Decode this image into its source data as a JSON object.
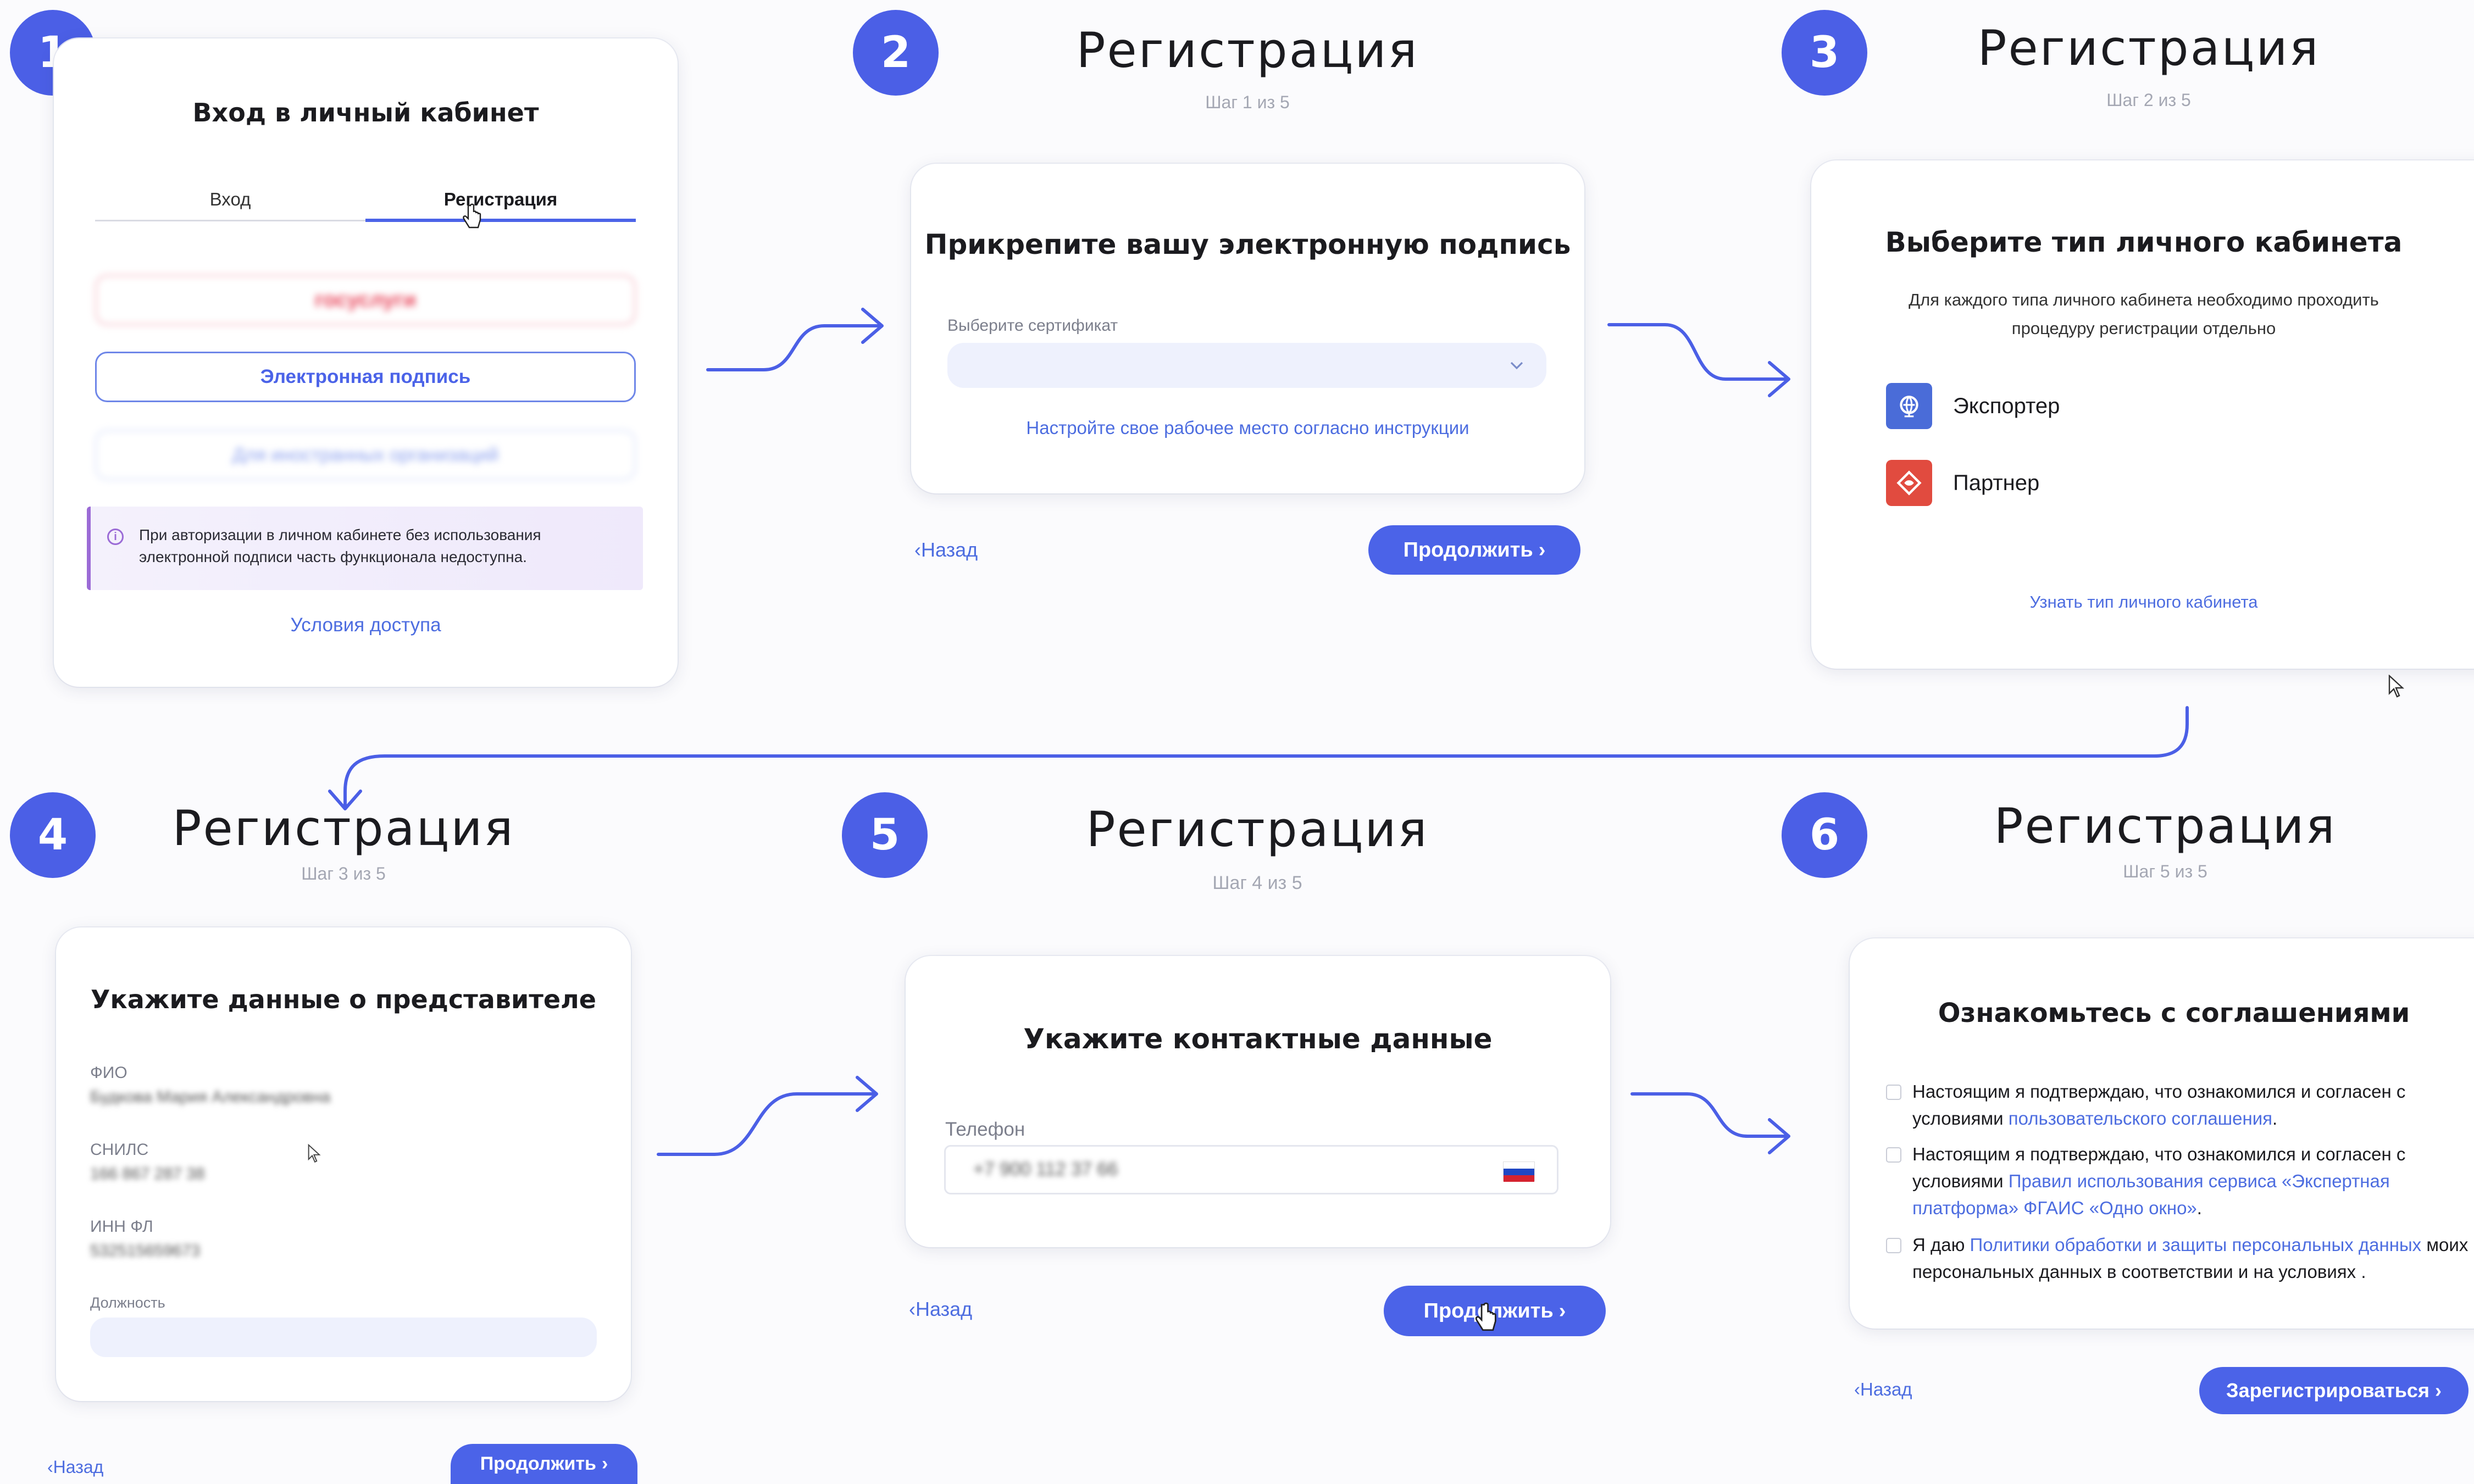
{
  "badges": [
    "1",
    "2",
    "3",
    "4",
    "5",
    "6"
  ],
  "reg_title": "Регистрация",
  "panel1": {
    "title": "Вход в личный кабинет",
    "tab_login": "Вход",
    "tab_register": "Регистрация",
    "gosuslugi_label": "госуслуги",
    "esign_button": "Электронная подпись",
    "org_button": "Для иностранных организаций",
    "info_text": "При авторизации в личном кабинете без использования электронной подписи часть функционала недоступна.",
    "access_link": "Условия доступа"
  },
  "panel2": {
    "step": "Шаг 1 из 5",
    "card_title": "Прикрепите вашу электронную подпись",
    "cert_label": "Выберите сертификат",
    "instruction_link": "Настройте свое рабочее место согласно инструкции",
    "back": "Назад",
    "continue": "Продолжить"
  },
  "panel3": {
    "step": "Шаг 2 из 5",
    "card_title": "Выберите тип личного кабинета",
    "description": "Для каждого типа личного кабинета необходимо проходить процедуру регистрации отдельно",
    "option_exporter": "Экспортер",
    "option_partner": "Партнер",
    "learn_link": "Узнать тип личного кабинета"
  },
  "panel4": {
    "step": "Шаг 3 из 5",
    "card_title": "Укажите данные о представителе",
    "fio_label": "ФИО",
    "fio_value": "Будкова Мария Александровна",
    "snils_label": "СНИЛС",
    "snils_value": "166 867 287 38",
    "inn_label": "ИНН ФЛ",
    "inn_value": "532515659673",
    "position_label": "Должность",
    "back": "Назад",
    "continue": "Продолжить"
  },
  "panel5": {
    "step": "Шаг 4 из 5",
    "card_title": "Укажите контактные данные",
    "phone_label": "Телефон",
    "phone_value": "+7 900 112 37 66",
    "back": "Назад",
    "continue": "Продолжить"
  },
  "panel6": {
    "step": "Шаг 5 из 5",
    "card_title": "Ознакомьтесь с соглашениями",
    "agree1_text": "Настоящим я подтверждаю, что ознакомился и согласен с условиями",
    "agree1_link": "пользовательского соглашения",
    "agree2_text": "Настоящим я подтверждаю, что ознакомился и согласен с условиями",
    "agree2_link": "Правил использования сервиса «Экспертная платформа» ФГАИС «Одно окно»",
    "agree3_prefix": "Я даю",
    "agree3_link": "Политики обработки и защиты персональных данных",
    "agree3_suffix": "моих персональных данных в соответствии и на условиях .",
    "back": "Назад",
    "register": "Зарегистрироваться"
  },
  "colors": {
    "accent": "#4b63e8",
    "badge": "#4b5fe6",
    "link": "#4d6de0",
    "exporter_icon": "#4a6cd8",
    "partner_icon": "#e14b3f",
    "info_bg": "#f2eefb",
    "info_bar": "#9b6bd6"
  }
}
